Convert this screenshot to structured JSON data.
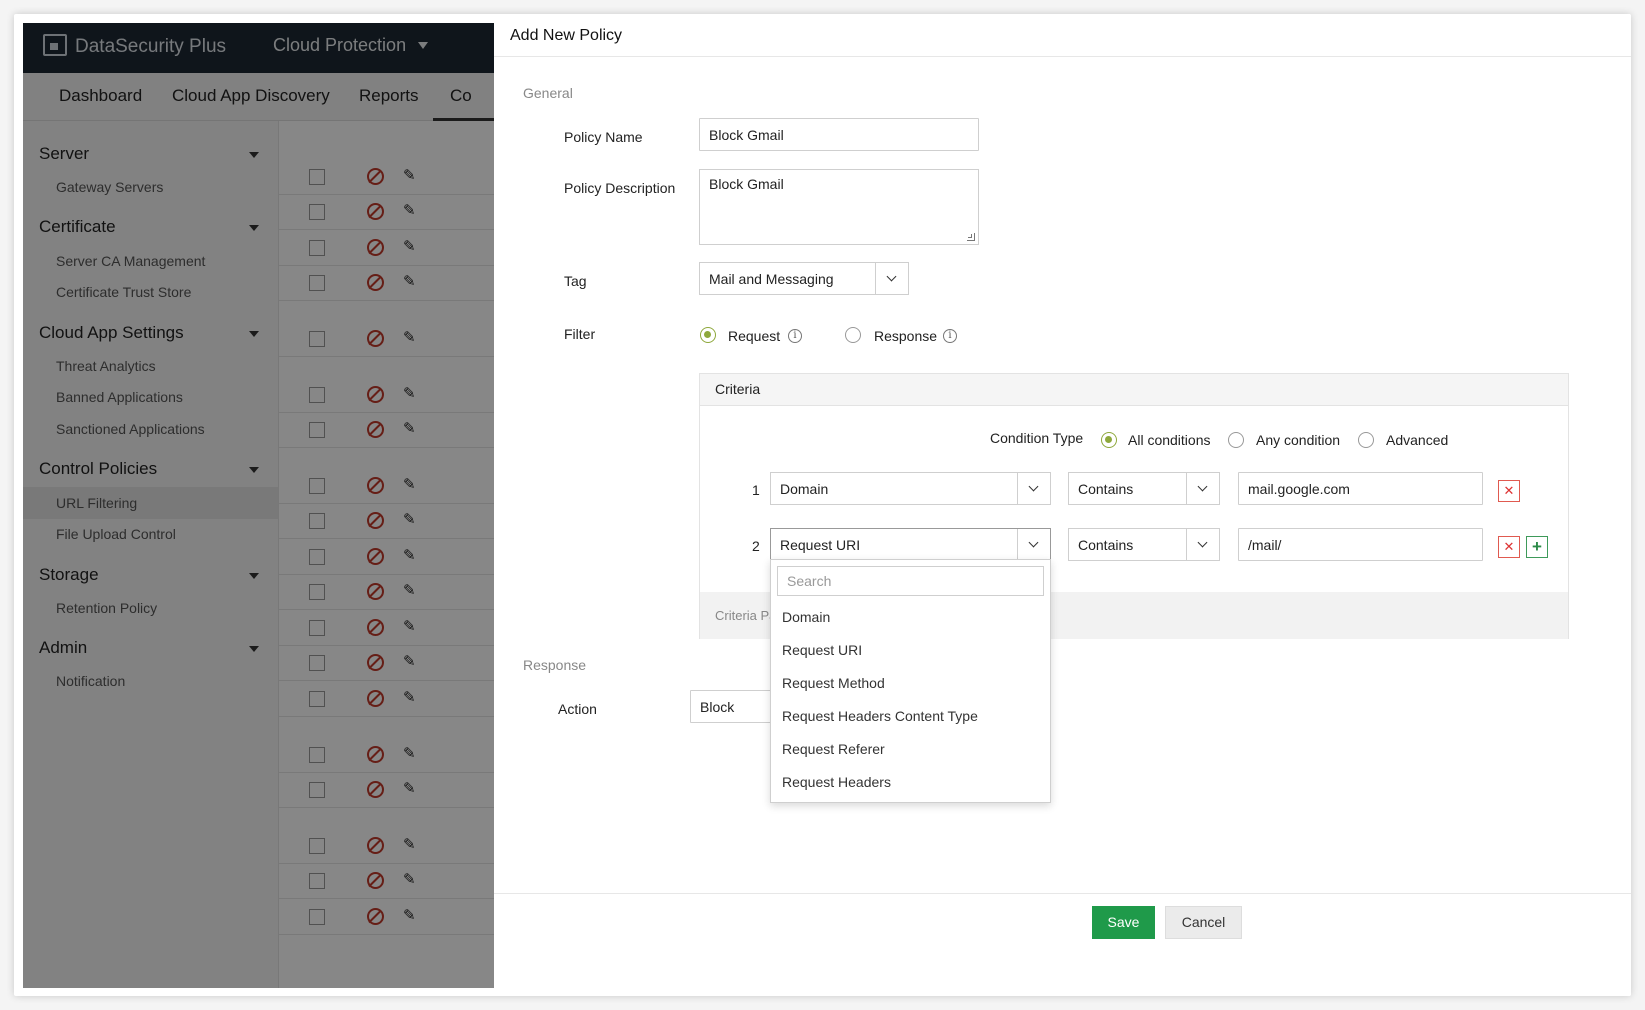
{
  "app": {
    "brand": "DataSecurity Plus",
    "product": "Cloud Protection"
  },
  "nav": {
    "tabs": [
      "Dashboard",
      "Cloud App Discovery",
      "Reports",
      "Co"
    ]
  },
  "sidebar": {
    "sections": [
      {
        "title": "Server",
        "items": [
          "Gateway Servers"
        ]
      },
      {
        "title": "Certificate",
        "items": [
          "Server CA Management",
          "Certificate Trust Store"
        ]
      },
      {
        "title": "Cloud App Settings",
        "items": [
          "Threat Analytics",
          "Banned Applications",
          "Sanctioned Applications"
        ]
      },
      {
        "title": "Control Policies",
        "items": [
          "URL Filtering",
          "File Upload Control"
        ]
      },
      {
        "title": "Storage",
        "items": [
          "Retention Policy"
        ]
      },
      {
        "title": "Admin",
        "items": [
          "Notification"
        ]
      }
    ],
    "active_item": "URL Filtering"
  },
  "modal": {
    "title": "Add New Policy",
    "general_label": "General",
    "policy_name_label": "Policy Name",
    "policy_name_value": "Block Gmail",
    "policy_description_label": "Policy Description",
    "policy_description_value": "Block Gmail",
    "tag_label": "Tag",
    "tag_value": "Mail and Messaging",
    "filter_label": "Filter",
    "filter_options": [
      "Request",
      "Response"
    ],
    "filter_selected": "Request",
    "criteria": {
      "header": "Criteria",
      "condition_type_label": "Condition Type",
      "condition_options": [
        "All conditions",
        "Any condition",
        "Advanced"
      ],
      "condition_selected": "All conditions",
      "rows": [
        {
          "num": "1",
          "field": "Domain",
          "operator": "Contains",
          "value": "mail.google.com"
        },
        {
          "num": "2",
          "field": "Request URI",
          "operator": "Contains",
          "value": "/mail/"
        }
      ],
      "footer_text": "Criteria Pa"
    },
    "dropdown": {
      "search_placeholder": "Search",
      "options": [
        "Domain",
        "Request URI",
        "Request Method",
        "Request Headers Content Type",
        "Request Referer",
        "Request Headers"
      ]
    },
    "response_label": "Response",
    "action_label": "Action",
    "action_value": "Block",
    "save_label": "Save",
    "cancel_label": "Cancel"
  },
  "colors": {
    "accent_green": "#1f9a4a",
    "radio_green": "#8ea83c",
    "delete_red": "#e05a50",
    "topbar": "#1e2833"
  }
}
